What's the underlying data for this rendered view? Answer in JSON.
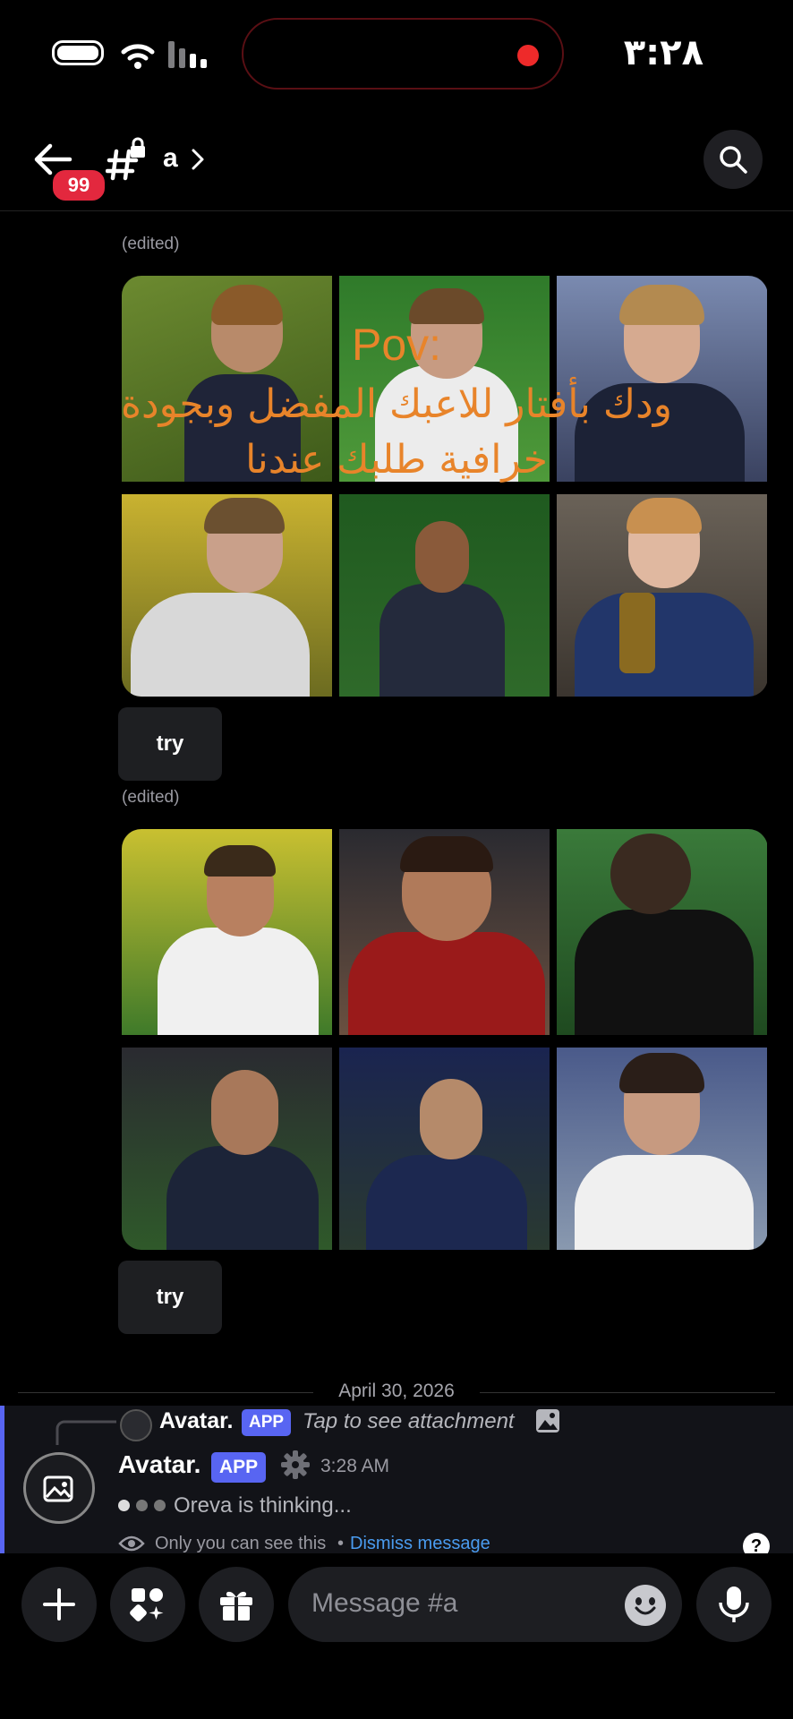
{
  "status_bar": {
    "time": "٣:٢٨",
    "record_color": "#ee2a2a"
  },
  "header": {
    "back_icon": "arrow-left-icon",
    "unread_count": "99",
    "channel_icon": "hash-lock-icon",
    "channel_name": "a",
    "chevron": "chevron-right-icon",
    "search_icon": "search-icon"
  },
  "messages": [
    {
      "edited": "(edited)",
      "overlay_line1": "Pov:",
      "overlay_line2": "ودك بأفتار للاعبك المفضل وبجودة",
      "overlay_line3": "خرافية طلبك عندنا",
      "button": "try",
      "images": 6
    },
    {
      "edited": "(edited)",
      "button": "try",
      "images": 6
    }
  ],
  "date_divider": "April 30, 2026",
  "reply_preview": {
    "name": "Avatar.",
    "tag": "APP",
    "text": "Tap to see attachment"
  },
  "bot_message": {
    "name": "Avatar.",
    "tag": "APP",
    "time": "3:28 AM",
    "status": "Oreva is thinking...",
    "ephemeral": "Only you can see this",
    "separator": "•",
    "dismiss": "Dismiss message"
  },
  "composer": {
    "placeholder": "Message #a",
    "icons": [
      "plus-icon",
      "apps-icon",
      "gift-icon",
      "emoji-icon",
      "microphone-icon"
    ]
  },
  "colors": {
    "accent": "#5865f2",
    "badge": "#e3283e",
    "overlay_text": "#e8842a",
    "link": "#4a9cf0"
  }
}
